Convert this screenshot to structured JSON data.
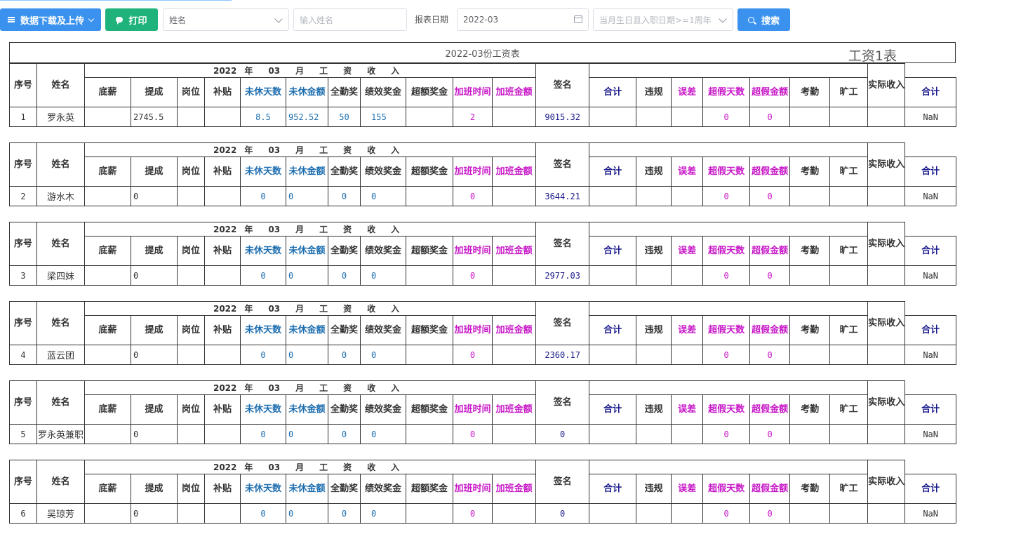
{
  "toolbar": {
    "download_label": "数据下载及上传",
    "print_label": "打印",
    "name_select_value": "姓名",
    "name_input_placeholder": "输入姓名",
    "date_label": "报表日期",
    "date_value": "2022-03",
    "filter_select_placeholder": "当月生日且入职日期>=1周年",
    "search_label": "搜索"
  },
  "sheet": {
    "title": "2022-03份工资表",
    "subtitle": "工资1表"
  },
  "headers": {
    "seq": "序号",
    "name": "姓名",
    "income_year": "2022",
    "income_y": "年",
    "income_month": "03",
    "income_m": "月",
    "income_w1": "工",
    "income_w2": "资",
    "income_w3": "收",
    "income_w4": "入",
    "base": "底薪",
    "commission": "提成",
    "post": "岗位",
    "allowance": "补贴",
    "unrest_days": "未休天数",
    "unrest_amount": "未休金额",
    "attendance_bonus": "全勤奖",
    "perf_bonus": "绩效奖金",
    "excess_bonus": "超额奖金",
    "ot_hours": "加班时间",
    "ot_amount": "加班金额",
    "total": "合计",
    "sign": "签名",
    "violation": "违规",
    "error": "误差",
    "over_leave_days": "超假天数",
    "over_leave_amount": "超假金额",
    "attendance": "考勤",
    "absent": "旷工",
    "ded_total": "合计",
    "actual": "实际收入"
  },
  "rows": [
    {
      "seq": "1",
      "name": "罗永英",
      "base": "",
      "commission": "2745.5",
      "post": "",
      "allowance": "",
      "unrest_days": "8.5",
      "unrest_amount": "952.52",
      "attendance_bonus": "50",
      "perf_bonus": "155",
      "excess_bonus": "",
      "ot_hours": "2",
      "ot_amount": "",
      "total": "9015.32",
      "sign": "",
      "violation": "",
      "error": "",
      "over_leave_days": "0",
      "over_leave_amount": "0",
      "attendance": "",
      "absent": "",
      "ded_total": "",
      "actual": "NaN"
    },
    {
      "seq": "2",
      "name": "游水木",
      "base": "",
      "commission": "0",
      "post": "",
      "allowance": "",
      "unrest_days": "0",
      "unrest_amount": "0",
      "attendance_bonus": "0",
      "perf_bonus": "0",
      "excess_bonus": "",
      "ot_hours": "0",
      "ot_amount": "",
      "total": "3644.21",
      "sign": "",
      "violation": "",
      "error": "",
      "over_leave_days": "0",
      "over_leave_amount": "0",
      "attendance": "",
      "absent": "",
      "ded_total": "",
      "actual": "NaN"
    },
    {
      "seq": "3",
      "name": "梁四妹",
      "base": "",
      "commission": "0",
      "post": "",
      "allowance": "",
      "unrest_days": "0",
      "unrest_amount": "0",
      "attendance_bonus": "0",
      "perf_bonus": "0",
      "excess_bonus": "",
      "ot_hours": "0",
      "ot_amount": "",
      "total": "2977.03",
      "sign": "",
      "violation": "",
      "error": "",
      "over_leave_days": "0",
      "over_leave_amount": "0",
      "attendance": "",
      "absent": "",
      "ded_total": "",
      "actual": "NaN"
    },
    {
      "seq": "4",
      "name": "蓝云团",
      "base": "",
      "commission": "0",
      "post": "",
      "allowance": "",
      "unrest_days": "0",
      "unrest_amount": "0",
      "attendance_bonus": "0",
      "perf_bonus": "0",
      "excess_bonus": "",
      "ot_hours": "0",
      "ot_amount": "",
      "total": "2360.17",
      "sign": "",
      "violation": "",
      "error": "",
      "over_leave_days": "0",
      "over_leave_amount": "0",
      "attendance": "",
      "absent": "",
      "ded_total": "",
      "actual": "NaN"
    },
    {
      "seq": "5",
      "name": "罗永英兼职",
      "base": "",
      "commission": "0",
      "post": "",
      "allowance": "",
      "unrest_days": "0",
      "unrest_amount": "0",
      "attendance_bonus": "0",
      "perf_bonus": "0",
      "excess_bonus": "",
      "ot_hours": "0",
      "ot_amount": "",
      "total": "0",
      "sign": "",
      "violation": "",
      "error": "",
      "over_leave_days": "0",
      "over_leave_amount": "0",
      "attendance": "",
      "absent": "",
      "ded_total": "",
      "actual": "NaN"
    },
    {
      "seq": "6",
      "name": "吴琼芳",
      "base": "",
      "commission": "0",
      "post": "",
      "allowance": "",
      "unrest_days": "0",
      "unrest_amount": "0",
      "attendance_bonus": "0",
      "perf_bonus": "0",
      "excess_bonus": "",
      "ot_hours": "0",
      "ot_amount": "",
      "total": "0",
      "sign": "",
      "violation": "",
      "error": "",
      "over_leave_days": "0",
      "over_leave_amount": "0",
      "attendance": "",
      "absent": "",
      "ded_total": "",
      "actual": "NaN"
    }
  ],
  "colors": {
    "primary": "#3b92ee",
    "success": "#1fb27a",
    "blue_text": "#1f6fb0",
    "magenta_text": "#c818c8",
    "navy_text": "#1a1a8c"
  }
}
